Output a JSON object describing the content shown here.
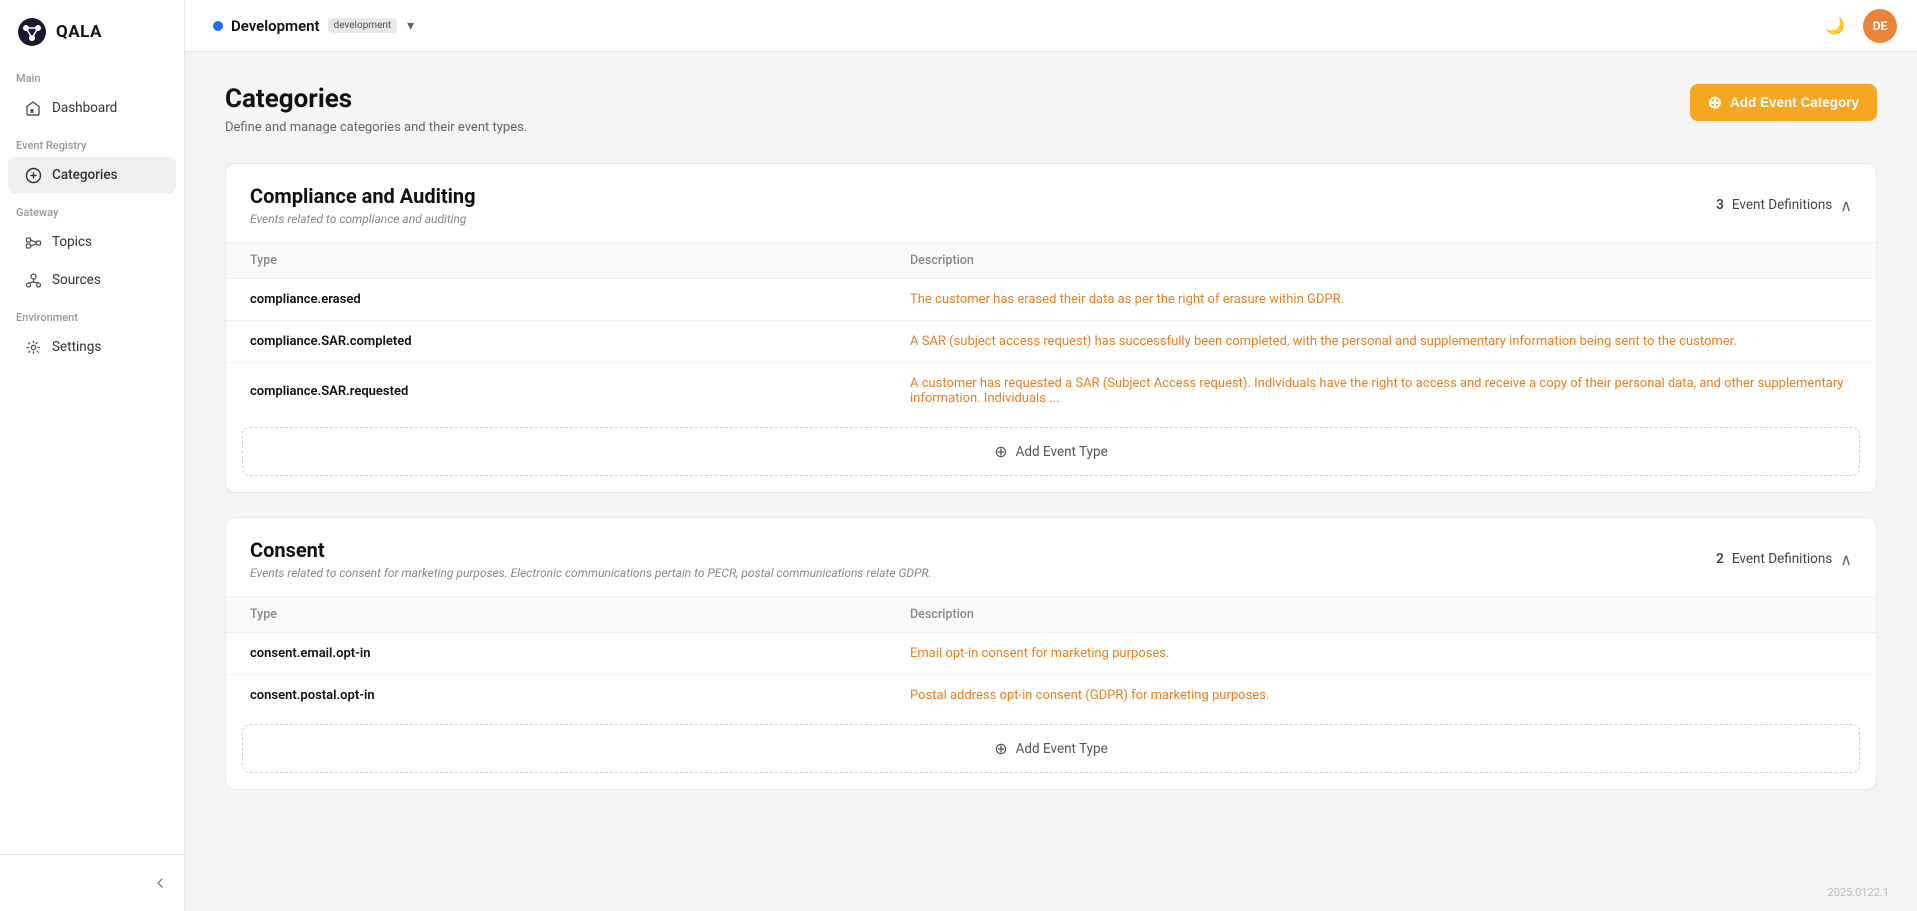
{
  "logo": {
    "alt": "QALA"
  },
  "sidebar": {
    "sections": [
      {
        "label": "Main",
        "items": [
          {
            "id": "dashboard",
            "label": "Dashboard",
            "icon": "home-icon",
            "active": false
          }
        ]
      },
      {
        "label": "Event Registry",
        "items": [
          {
            "id": "categories",
            "label": "Categories",
            "icon": "categories-icon",
            "active": true
          }
        ]
      },
      {
        "label": "Gateway",
        "items": [
          {
            "id": "topics",
            "label": "Topics",
            "icon": "topics-icon",
            "active": false
          },
          {
            "id": "sources",
            "label": "Sources",
            "icon": "sources-icon",
            "active": false
          }
        ]
      },
      {
        "label": "Environment",
        "items": [
          {
            "id": "settings",
            "label": "Settings",
            "icon": "settings-icon",
            "active": false
          }
        ]
      }
    ]
  },
  "topbar": {
    "env_dot_color": "#1a73e8",
    "env_name": "Development",
    "env_badge": "development",
    "avatar_initials": "DE",
    "avatar_color": "#e8833a"
  },
  "page": {
    "title": "Categories",
    "subtitle": "Define and manage categories and their event types.",
    "add_button_label": "Add Event Category"
  },
  "categories": [
    {
      "id": "compliance",
      "title": "Compliance and Auditing",
      "description": "Events related to compliance and auditing",
      "event_count": 3,
      "event_definitions_label": "Event Definitions",
      "columns": {
        "type": "Type",
        "description": "Description"
      },
      "events": [
        {
          "type": "compliance.erased",
          "description": "The customer has erased their data as per the right of erasure within GDPR."
        },
        {
          "type": "compliance.SAR.completed",
          "description": "A SAR (subject access request) has successfully been completed, with the personal and supplementary information being sent to the customer."
        },
        {
          "type": "compliance.SAR.requested",
          "description": "A customer has requested a SAR (Subject Access request). Individuals have the right to access and receive a copy of their personal data, and other supplementary information. Individuals ..."
        }
      ],
      "add_event_label": "Add Event Type"
    },
    {
      "id": "consent",
      "title": "Consent",
      "description": "Events related to consent for marketing purposes. Electronic communications pertain to PECR, postal communications relate GDPR.",
      "event_count": 2,
      "event_definitions_label": "Event Definitions",
      "columns": {
        "type": "Type",
        "description": "Description"
      },
      "events": [
        {
          "type": "consent.email.opt-in",
          "description": "Email opt-in consent for marketing purposes."
        },
        {
          "type": "consent.postal.opt-in",
          "description": "Postal address opt-in consent (GDPR) for marketing purposes."
        }
      ],
      "add_event_label": "Add Event Type"
    }
  ],
  "version": "2025.0122.1"
}
